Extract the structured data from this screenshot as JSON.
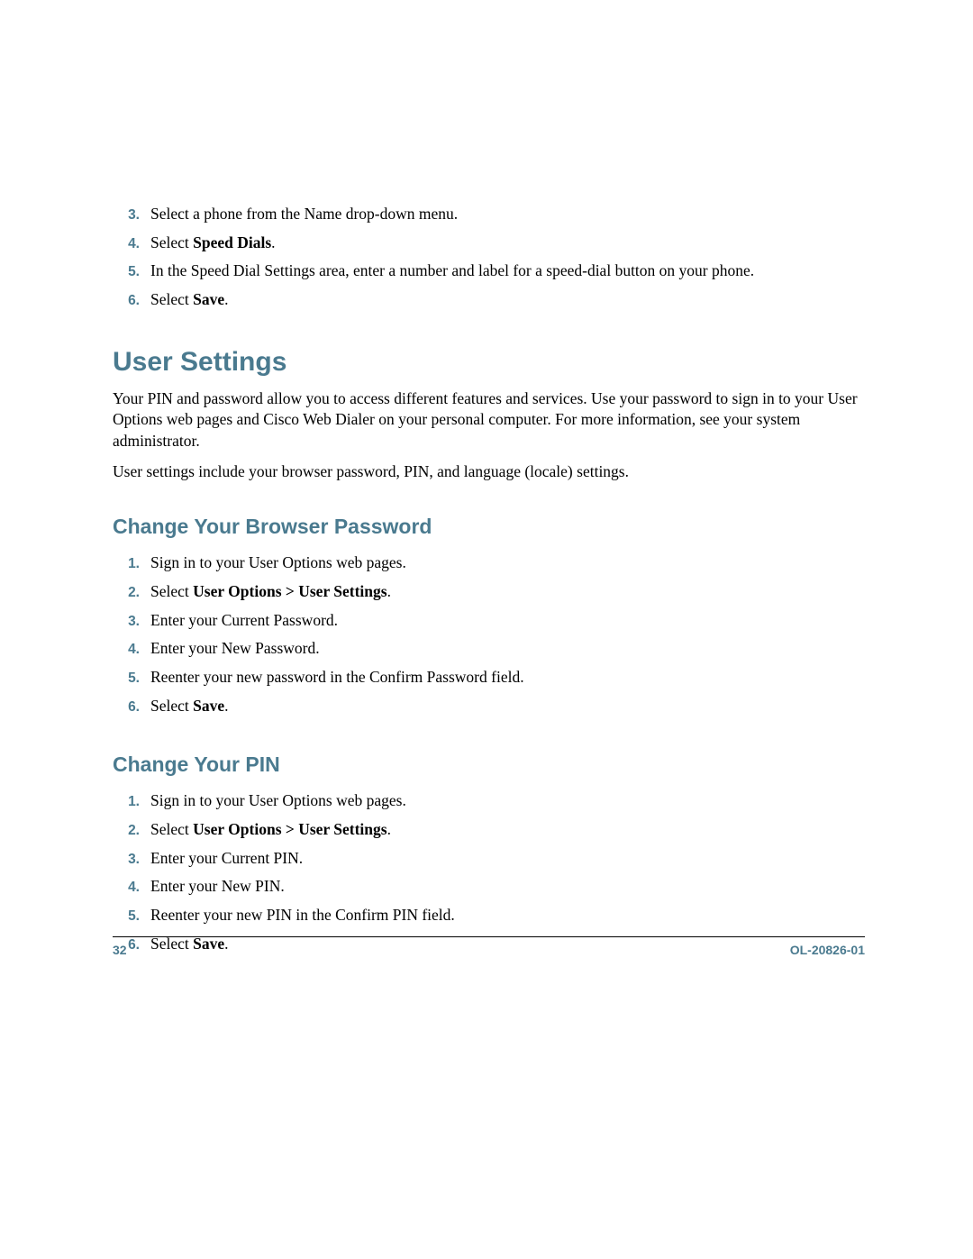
{
  "initialList": [
    {
      "num": "3.",
      "segments": [
        {
          "text": "Select a phone from the Name drop-down menu.",
          "bold": false
        }
      ]
    },
    {
      "num": "4.",
      "segments": [
        {
          "text": "Select ",
          "bold": false
        },
        {
          "text": "Speed Dials",
          "bold": true
        },
        {
          "text": ".",
          "bold": false
        }
      ]
    },
    {
      "num": "5.",
      "segments": [
        {
          "text": "In the Speed Dial Settings area, enter a number and label for a speed-dial button on your phone.",
          "bold": false
        }
      ]
    },
    {
      "num": "6.",
      "segments": [
        {
          "text": "Select ",
          "bold": false
        },
        {
          "text": "Save",
          "bold": true
        },
        {
          "text": ".",
          "bold": false
        }
      ]
    }
  ],
  "userSettings": {
    "heading": "User Settings",
    "para1": "Your PIN and password allow you to access different features and services. Use your password to sign in to your User Options web pages and Cisco Web Dialer on your personal computer. For more information, see your system administrator.",
    "para2": "User settings include your browser password, PIN, and language (locale) settings."
  },
  "changeBrowserPassword": {
    "heading": "Change Your Browser Password",
    "steps": [
      {
        "num": "1.",
        "segments": [
          {
            "text": "Sign in to your User Options web pages.",
            "bold": false
          }
        ]
      },
      {
        "num": "2.",
        "segments": [
          {
            "text": "Select ",
            "bold": false
          },
          {
            "text": "User Options > User Settings",
            "bold": true
          },
          {
            "text": ".",
            "bold": false
          }
        ]
      },
      {
        "num": "3.",
        "segments": [
          {
            "text": "Enter your Current Password.",
            "bold": false
          }
        ]
      },
      {
        "num": "4.",
        "segments": [
          {
            "text": "Enter your New Password.",
            "bold": false
          }
        ]
      },
      {
        "num": "5.",
        "segments": [
          {
            "text": "Reenter your new password in the Confirm Password field.",
            "bold": false
          }
        ]
      },
      {
        "num": "6.",
        "segments": [
          {
            "text": "Select ",
            "bold": false
          },
          {
            "text": "Save",
            "bold": true
          },
          {
            "text": ".",
            "bold": false
          }
        ]
      }
    ]
  },
  "changeYourPin": {
    "heading": "Change Your PIN",
    "steps": [
      {
        "num": "1.",
        "segments": [
          {
            "text": "Sign in to your User Options web pages.",
            "bold": false
          }
        ]
      },
      {
        "num": "2.",
        "segments": [
          {
            "text": "Select ",
            "bold": false
          },
          {
            "text": "User Options > User Settings",
            "bold": true
          },
          {
            "text": ".",
            "bold": false
          }
        ]
      },
      {
        "num": "3.",
        "segments": [
          {
            "text": "Enter your Current PIN.",
            "bold": false
          }
        ]
      },
      {
        "num": "4.",
        "segments": [
          {
            "text": "Enter your New PIN.",
            "bold": false
          }
        ]
      },
      {
        "num": "5.",
        "segments": [
          {
            "text": "Reenter your new PIN in the Confirm PIN field.",
            "bold": false
          }
        ]
      },
      {
        "num": "6.",
        "segments": [
          {
            "text": "Select ",
            "bold": false
          },
          {
            "text": "Save",
            "bold": true
          },
          {
            "text": ".",
            "bold": false
          }
        ]
      }
    ]
  },
  "footer": {
    "pageNumber": "32",
    "docId": "OL-20826-01"
  }
}
